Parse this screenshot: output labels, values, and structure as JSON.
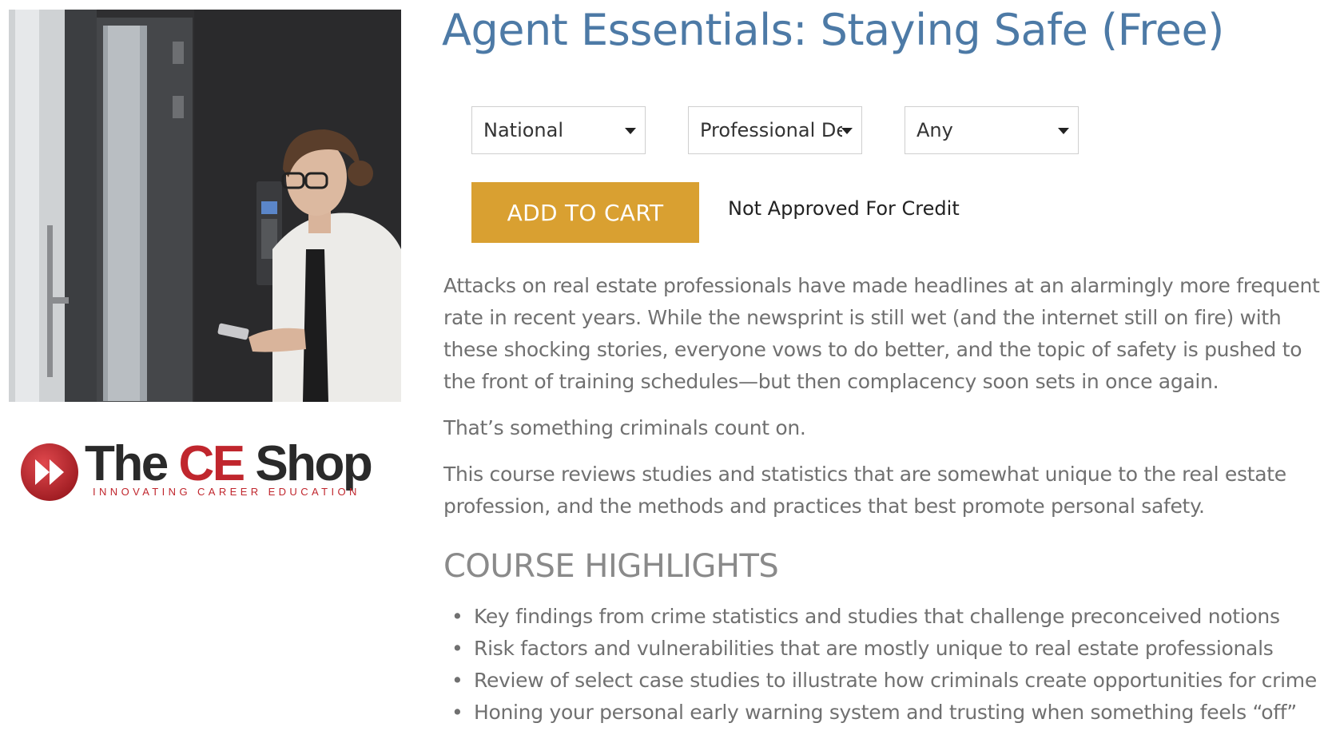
{
  "course": {
    "title": "Agent Essentials: Staying Safe (Free)"
  },
  "brand": {
    "logo_word1": "The ",
    "logo_word2": "CE",
    "logo_word3": " Shop",
    "logo_tagline": "INNOVATING CAREER EDUCATION",
    "logo_icon": "fast-forward-icon",
    "accent_red": "#c0262d",
    "title_blue": "#4d7aa6",
    "button_gold": "#d9a031"
  },
  "filters": {
    "state": {
      "value": "National",
      "icon": "caret-down-icon"
    },
    "type": {
      "value": "Professional Development",
      "icon": "caret-down-icon"
    },
    "option": {
      "value": "Any",
      "icon": "caret-down-icon"
    }
  },
  "purchase": {
    "add_to_cart_label": "ADD TO CART",
    "credit_status": "Not Approved For Credit"
  },
  "description": {
    "paragraph1": "Attacks on real estate professionals have made headlines at an alarmingly more frequent rate in recent years. While the newsprint is still wet (and the internet still on fire) with these shocking stories, everyone vows to do better, and the topic of safety is pushed to the front of training schedules—but then complacency soon sets in once again.",
    "paragraph2": "That’s something criminals count on.",
    "paragraph3": "This course reviews studies and statistics that are somewhat unique to the real estate profession, and the methods and practices that best promote personal safety."
  },
  "highlights": {
    "heading": "COURSE HIGHLIGHTS",
    "items": [
      "Key findings from crime statistics and studies that challenge preconceived notions",
      "Risk factors and vulnerabilities that are mostly unique to real estate professionals",
      "Review of select case studies to illustrate how criminals create opportunities for crime",
      "Honing your personal early warning system and trusting when something feels “off”"
    ]
  }
}
